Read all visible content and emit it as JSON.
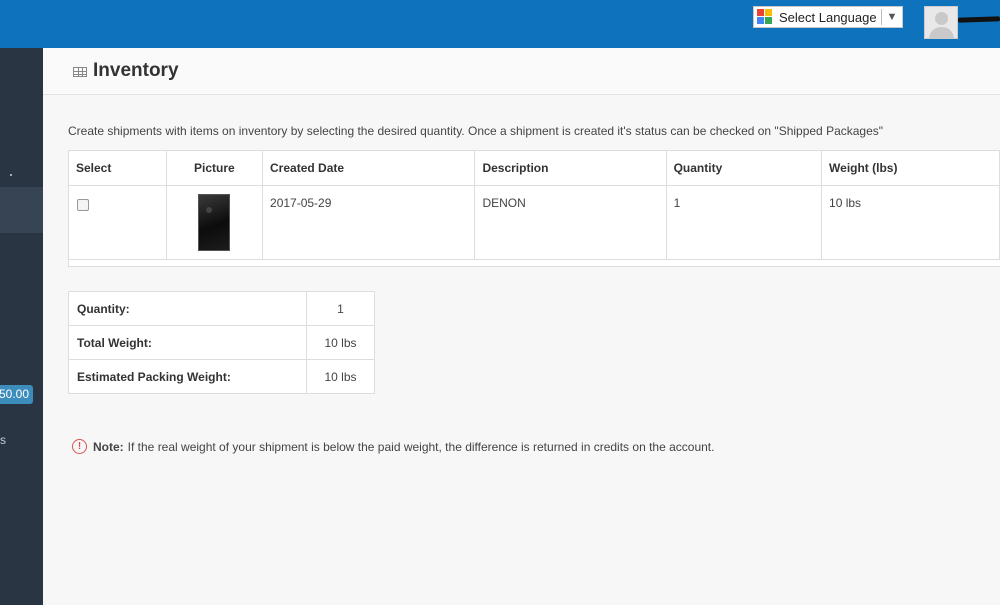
{
  "topbar": {
    "language_label": "Select Language",
    "language_arrow": "▼",
    "colors": {
      "bar": "#0f72bd",
      "sidebar": "#2a3543"
    }
  },
  "sidebar": {
    "badge": "50.00",
    "partial_text": "s"
  },
  "page": {
    "title": "Inventory",
    "intro": "Create shipments with items on inventory by selecting the desired quantity. Once a shipment is created it's status can be checked on \"Shipped Packages\""
  },
  "inventory_table": {
    "headers": [
      "Select",
      "Picture",
      "Created Date",
      "Description",
      "Quantity",
      "Weight (lbs)"
    ],
    "rows": [
      {
        "created_date": "2017-05-29",
        "description": "DENON",
        "quantity": "1",
        "weight": "10 lbs",
        "checked": false
      }
    ]
  },
  "summary": {
    "rows": [
      {
        "label": "Quantity:",
        "value": "1"
      },
      {
        "label": "Total Weight:",
        "value": "10 lbs"
      },
      {
        "label": "Estimated Packing Weight:",
        "value": "10 lbs"
      }
    ]
  },
  "note": {
    "icon": "!",
    "label": "Note:",
    "text": "If the real weight of your shipment is below the paid weight, the difference is returned in credits on the account."
  }
}
